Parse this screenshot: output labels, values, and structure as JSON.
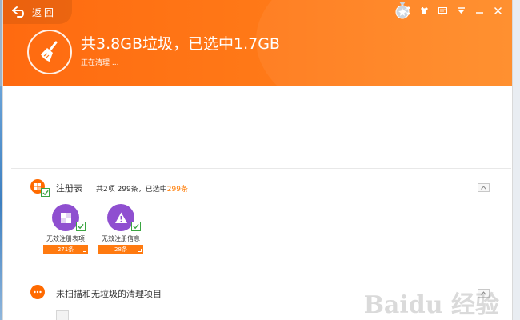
{
  "header": {
    "back_label": "返回",
    "title": "共3.8GB垃圾，已选中1.7GB",
    "status": "正在清理 ..."
  },
  "top_icons": [
    "medal-icon",
    "share-icon",
    "skin-icon",
    "feedback-icon",
    "menu-icon",
    "minimize-icon",
    "close-icon"
  ],
  "colors": {
    "header_orange": "#ff7a18",
    "accent_orange": "#ff7a00",
    "item_purple": "#8f4fd0",
    "check_green": "#3aa541"
  },
  "registry": {
    "title": "注册表",
    "meta_prefix": "共2项 299条，已选中",
    "meta_selected": "299条",
    "items": [
      {
        "label": "无效注册表项",
        "count": "271条",
        "icon": "registry-icon"
      },
      {
        "label": "无效注册信息",
        "count": "28条",
        "icon": "warning-icon"
      }
    ]
  },
  "unscanned": {
    "title": "未扫描和无垃圾的清理项目"
  },
  "watermark": "Baidu 经验"
}
